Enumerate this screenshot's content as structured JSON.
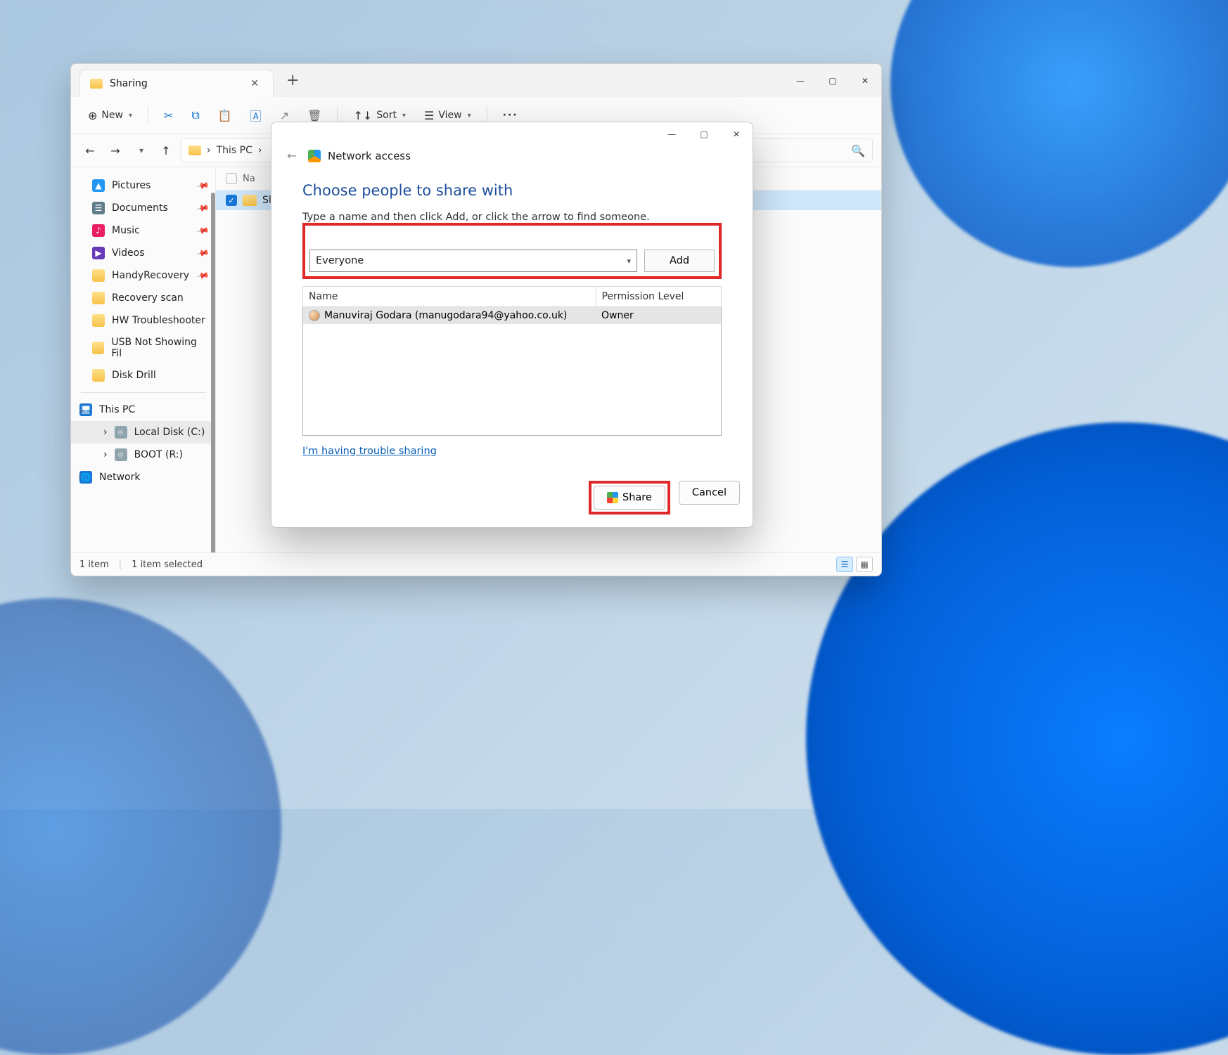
{
  "explorer": {
    "tab_title": "Sharing",
    "toolbar": {
      "new": "New",
      "sort": "Sort",
      "view": "View"
    },
    "breadcrumb": {
      "root": "This PC",
      "chev": "›"
    },
    "sidebar": {
      "items": [
        {
          "label": "Pictures",
          "icon": "pictures",
          "pinned": true
        },
        {
          "label": "Documents",
          "icon": "documents",
          "pinned": true
        },
        {
          "label": "Music",
          "icon": "music",
          "pinned": true
        },
        {
          "label": "Videos",
          "icon": "videos",
          "pinned": true
        },
        {
          "label": "HandyRecovery",
          "icon": "folder",
          "pinned": true
        },
        {
          "label": "Recovery scan",
          "icon": "folder"
        },
        {
          "label": "HW Troubleshooter",
          "icon": "folder"
        },
        {
          "label": "USB Not Showing Fil",
          "icon": "folder"
        },
        {
          "label": "Disk Drill",
          "icon": "folder"
        }
      ],
      "this_pc": "This PC",
      "drives": [
        {
          "label": "Local Disk (C:)",
          "icon": "disk",
          "selected": true
        },
        {
          "label": "BOOT (R:)",
          "icon": "disk"
        }
      ],
      "network": "Network"
    },
    "list": {
      "header_name": "Na",
      "row_name_visible": "Sl"
    },
    "status": {
      "items": "1 item",
      "selected": "1 item selected"
    }
  },
  "dialog": {
    "title": "Network access",
    "heading": "Choose people to share with",
    "sub": "Type a name and then click Add, or click the arrow to find someone.",
    "combo_value": "Everyone",
    "add": "Add",
    "col_name": "Name",
    "col_perm": "Permission Level",
    "rows": [
      {
        "name": "Manuviraj Godara (manugodara94@yahoo.co.uk)",
        "perm": "Owner"
      }
    ],
    "trouble": "I'm having trouble sharing",
    "share": "Share",
    "cancel": "Cancel"
  }
}
